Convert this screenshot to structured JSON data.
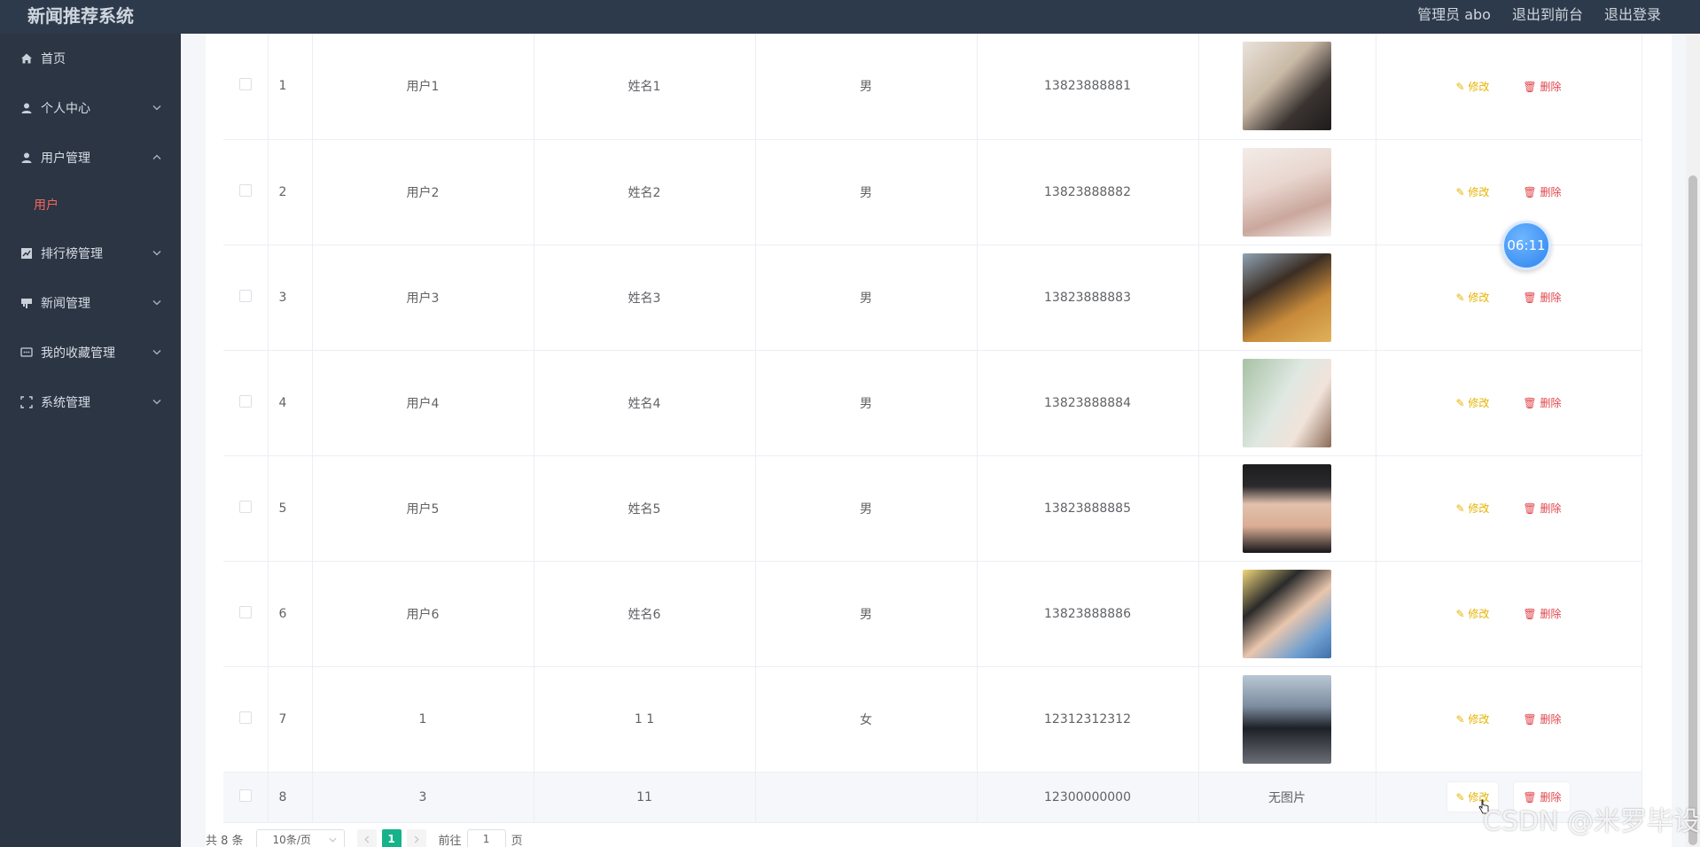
{
  "app": {
    "title": "新闻推荐系统"
  },
  "header": {
    "admin": "管理员 abo",
    "to_front": "退出到前台",
    "logout": "退出登录"
  },
  "sidebar": {
    "items": [
      {
        "label": "首页",
        "icon": "home-icon",
        "expanded": false,
        "has_children": false
      },
      {
        "label": "个人中心",
        "icon": "user-icon",
        "expanded": false,
        "has_children": true
      },
      {
        "label": "用户管理",
        "icon": "user-icon",
        "expanded": true,
        "has_children": true,
        "children": [
          {
            "label": "用户",
            "active": true
          }
        ]
      },
      {
        "label": "排行榜管理",
        "icon": "chart-icon",
        "expanded": false,
        "has_children": true
      },
      {
        "label": "新闻管理",
        "icon": "news-icon",
        "expanded": false,
        "has_children": true
      },
      {
        "label": "我的收藏管理",
        "icon": "message-icon",
        "expanded": false,
        "has_children": true
      },
      {
        "label": "系统管理",
        "icon": "fullscreen-icon",
        "expanded": false,
        "has_children": true
      }
    ]
  },
  "table": {
    "rows": [
      {
        "index": "1",
        "account": "用户1",
        "name": "姓名1",
        "gender": "男",
        "phone": "13823888881",
        "photo": "avatar-photo-1"
      },
      {
        "index": "2",
        "account": "用户2",
        "name": "姓名2",
        "gender": "男",
        "phone": "13823888882",
        "photo": "avatar-photo-2"
      },
      {
        "index": "3",
        "account": "用户3",
        "name": "姓名3",
        "gender": "男",
        "phone": "13823888883",
        "photo": "avatar-photo-3"
      },
      {
        "index": "4",
        "account": "用户4",
        "name": "姓名4",
        "gender": "男",
        "phone": "13823888884",
        "photo": "avatar-photo-4"
      },
      {
        "index": "5",
        "account": "用户5",
        "name": "姓名5",
        "gender": "男",
        "phone": "13823888885",
        "photo": "avatar-photo-5"
      },
      {
        "index": "6",
        "account": "用户6",
        "name": "姓名6",
        "gender": "男",
        "phone": "13823888886",
        "photo": "avatar-photo-6"
      },
      {
        "index": "7",
        "account": "1",
        "name": "1 1",
        "gender": "女",
        "phone": "12312312312",
        "photo": "avatar-photo-7"
      },
      {
        "index": "8",
        "account": "3",
        "name": "11",
        "gender": "",
        "phone": "12300000000",
        "photo_text": "无图片"
      }
    ],
    "edit_label": "修改",
    "delete_label": "删除"
  },
  "pagination": {
    "total": "共 8 条",
    "page_size": "10条/页",
    "current_page": "1",
    "goto_prefix": "前往",
    "goto_value": "1",
    "goto_suffix": "页"
  },
  "timer": "06:11",
  "watermark": "CSDN @米罗毕设",
  "colors": {
    "topbar": "#2d3a4b",
    "sidebar": "#2b3544",
    "active_submenu": "#f4685e",
    "edit": "#e6b400",
    "delete": "#e0454a",
    "pager_active": "#16b38a"
  }
}
